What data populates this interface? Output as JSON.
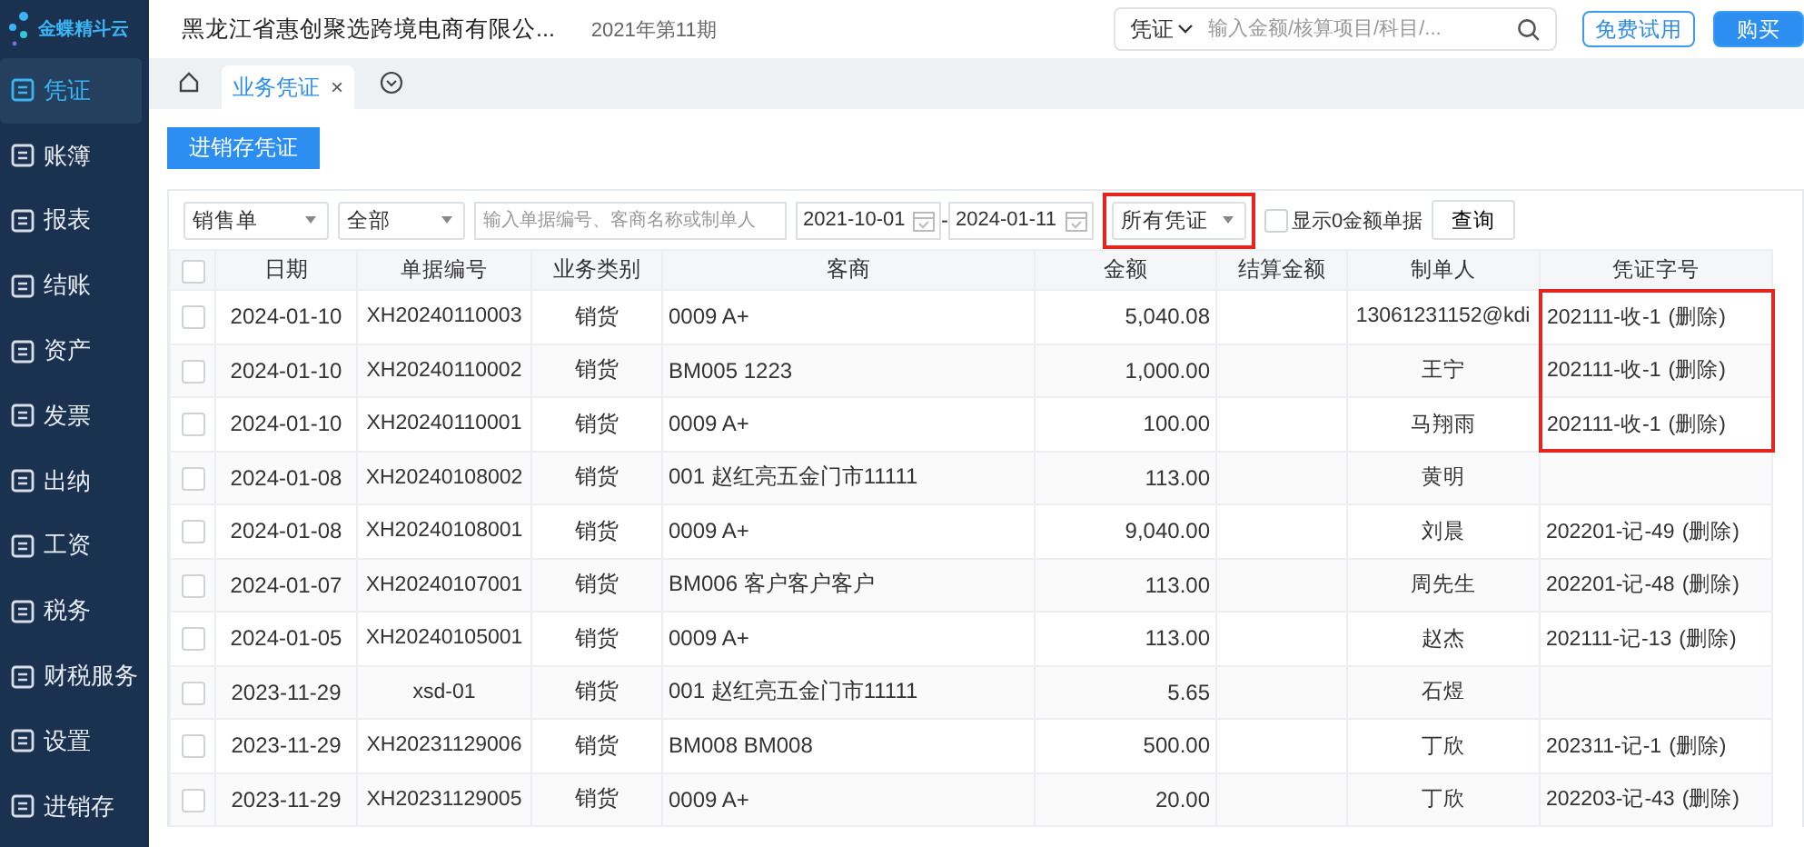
{
  "sidebar": {
    "logo": "金蝶精斗云",
    "items": [
      {
        "label": "凭证",
        "selected": true
      },
      {
        "label": "账簿",
        "selected": false
      },
      {
        "label": "报表",
        "selected": false
      },
      {
        "label": "结账",
        "selected": false
      },
      {
        "label": "资产",
        "selected": false
      },
      {
        "label": "发票",
        "selected": false
      },
      {
        "label": "出纳",
        "selected": false
      },
      {
        "label": "工资",
        "selected": false
      },
      {
        "label": "税务",
        "selected": false
      },
      {
        "label": "财税服务",
        "selected": false
      },
      {
        "label": "设置",
        "selected": false
      },
      {
        "label": "进销存",
        "selected": false
      }
    ]
  },
  "header": {
    "company": "黑龙江省惠创聚选跨境电商有限公...",
    "period": "2021年第11期",
    "search": {
      "scope": "凭证",
      "placeholder": "输入金额/核算项目/科目/..."
    },
    "buttons": [
      {
        "label": "免费试用",
        "kind": "outline"
      },
      {
        "label": "购买",
        "kind": "primary"
      }
    ]
  },
  "tabs": [
    {
      "label": "业务凭证",
      "selected": true,
      "close": "×"
    }
  ],
  "action_button": "进销存凭证",
  "filters": {
    "doc_type": "销售单",
    "status": "全部",
    "keyword_placeholder": "输入单据编号、客商名称或制单人",
    "date_from": "2021-10-01",
    "date_to": "2024-01-11",
    "separator": "-",
    "voucher_filter": {
      "value": "所有凭证",
      "highlighted": true
    },
    "show_zero": {
      "label": "显示0金额单据",
      "checked": false
    },
    "query_button": "查询"
  },
  "table": {
    "select_all_checked": false,
    "columns": [
      "日期",
      "单据编号",
      "业务类别",
      "客商",
      "金额",
      "结算金额",
      "制单人",
      "凭证字号"
    ],
    "rows": [
      {
        "checked": false,
        "date": "2024-01-10",
        "number": "XH20240110003",
        "category": "销货",
        "partner": "0009 A+",
        "amount": "5,040.08",
        "creator": "13061231152@kdi",
        "voucher": "202111-收-1",
        "action": "(删除)",
        "highlighted": true
      },
      {
        "checked": false,
        "date": "2024-01-10",
        "number": "XH20240110002",
        "category": "销货",
        "partner": "BM005 1223",
        "amount": "1,000.00",
        "creator": "王宁",
        "voucher": "202111-收-1",
        "action": "(删除)",
        "highlighted": true
      },
      {
        "checked": false,
        "date": "2024-01-10",
        "number": "XH20240110001",
        "category": "销货",
        "partner": "0009 A+",
        "amount": "100.00",
        "creator": "马翔雨",
        "voucher": "202111-收-1",
        "action": "(删除)",
        "highlighted": true
      },
      {
        "checked": false,
        "date": "2024-01-08",
        "number": "XH20240108002",
        "category": "销货",
        "partner": "001 赵红亮五金门市11111",
        "amount": "113.00",
        "creator": "黄明",
        "highlighted": false
      },
      {
        "checked": false,
        "date": "2024-01-08",
        "number": "XH20240108001",
        "category": "销货",
        "partner": "0009 A+",
        "amount": "9,040.00",
        "creator": "刘晨",
        "voucher": "202201-记-49",
        "action": "(删除)",
        "highlighted": false
      },
      {
        "checked": false,
        "date": "2024-01-07",
        "number": "XH20240107001",
        "category": "销货",
        "partner": "BM006 客户客户客户",
        "amount": "113.00",
        "creator": "周先生",
        "voucher": "202201-记-48",
        "action": "(删除)",
        "highlighted": false
      },
      {
        "checked": false,
        "date": "2024-01-05",
        "number": "XH20240105001",
        "category": "销货",
        "partner": "0009 A+",
        "amount": "113.00",
        "creator": "赵杰",
        "voucher": "202111-记-13",
        "action": "(删除)",
        "highlighted": false
      },
      {
        "checked": false,
        "date": "2023-11-29",
        "number": "xsd-01",
        "category": "销货",
        "partner": "001 赵红亮五金门市11111",
        "amount": "5.65",
        "creator": "石煜",
        "highlighted": false
      },
      {
        "checked": false,
        "date": "2023-11-29",
        "number": "XH20231129006",
        "category": "销货",
        "partner": "BM008 BM008",
        "amount": "500.00",
        "creator": "丁欣",
        "voucher": "202311-记-1",
        "action": "(删除)",
        "highlighted": false
      },
      {
        "checked": false,
        "date": "2023-11-29",
        "number": "XH20231129005",
        "category": "销货",
        "partner": "0009 A+",
        "amount": "20.00",
        "creator": "丁欣",
        "voucher": "202203-记-43",
        "action": "(删除)",
        "highlighted": false
      }
    ]
  }
}
